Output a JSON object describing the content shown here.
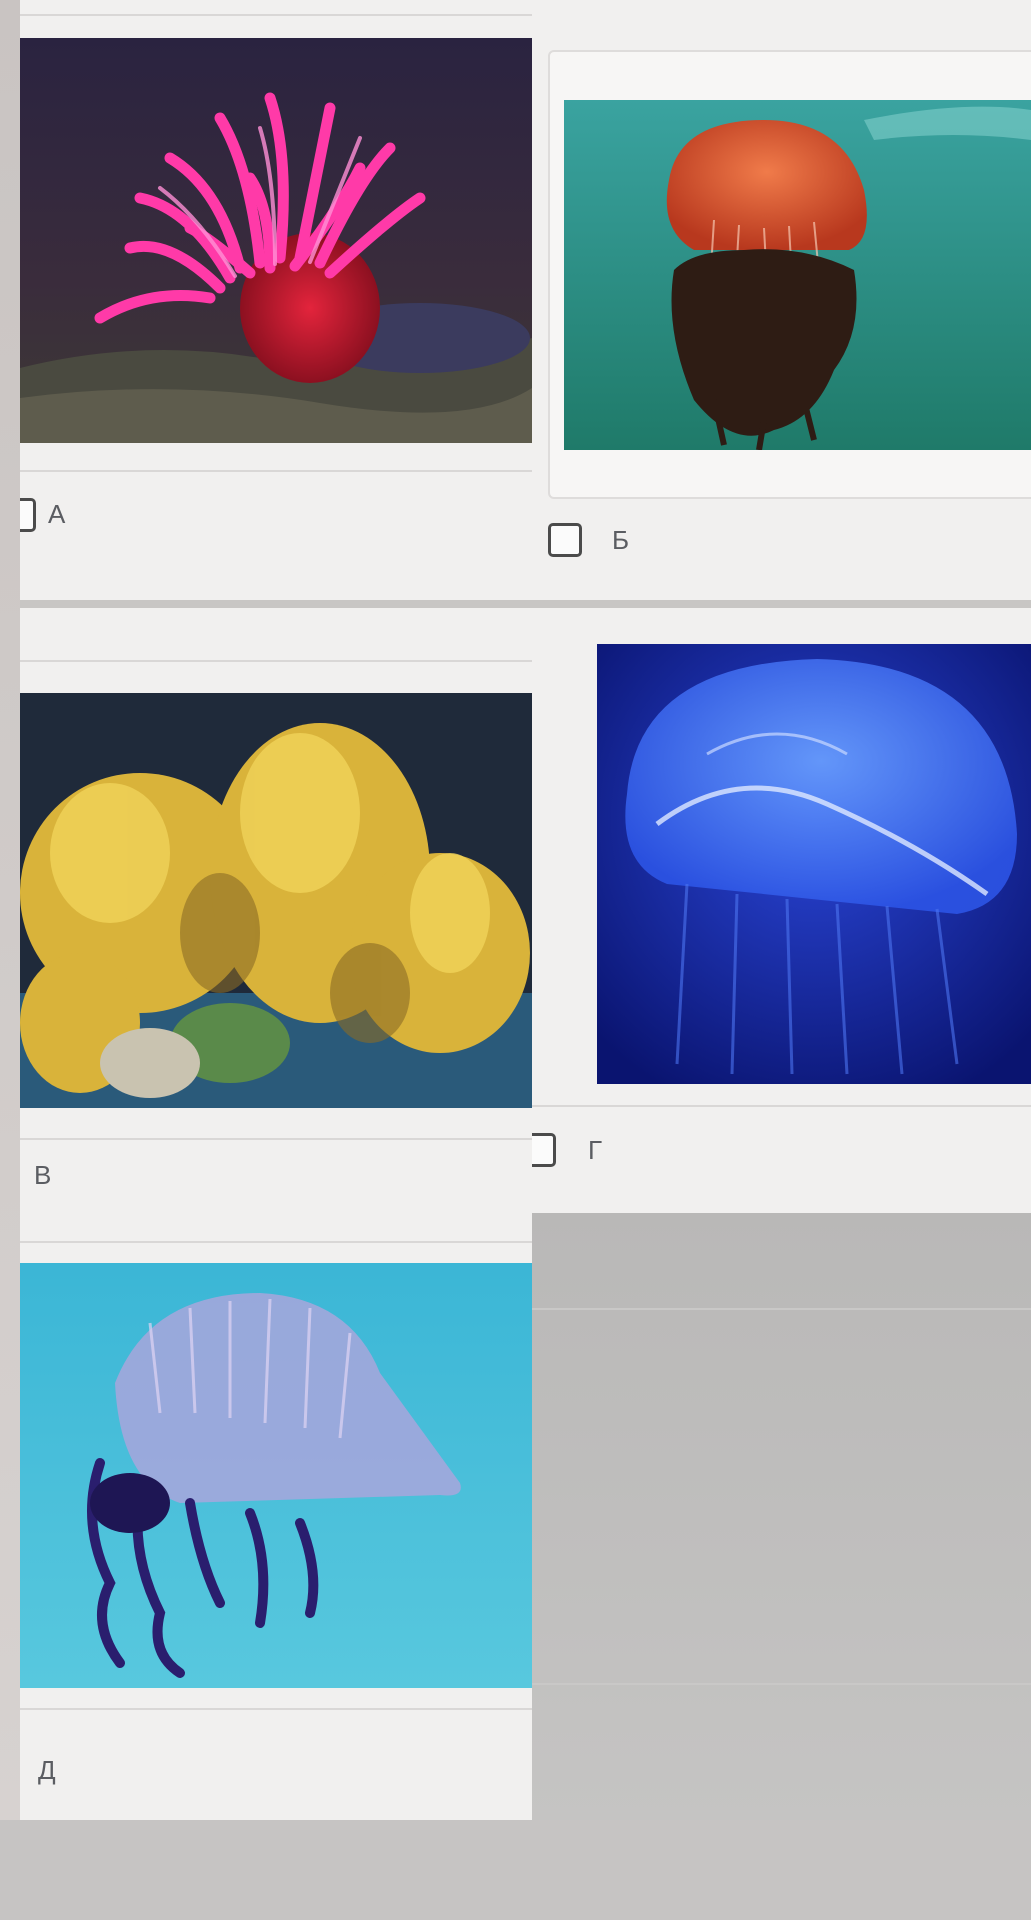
{
  "options": [
    {
      "id": "a",
      "label": "А",
      "checked": false
    },
    {
      "id": "b",
      "label": "Б",
      "checked": false
    },
    {
      "id": "v",
      "label": "В",
      "checked": false
    },
    {
      "id": "g",
      "label": "Г",
      "checked": false
    },
    {
      "id": "d",
      "label": "Д",
      "checked": false
    }
  ],
  "colors": {
    "panel": "#f1f0ef",
    "checkbox_border": "#4b4b4b",
    "label_text": "#5b5d62"
  }
}
